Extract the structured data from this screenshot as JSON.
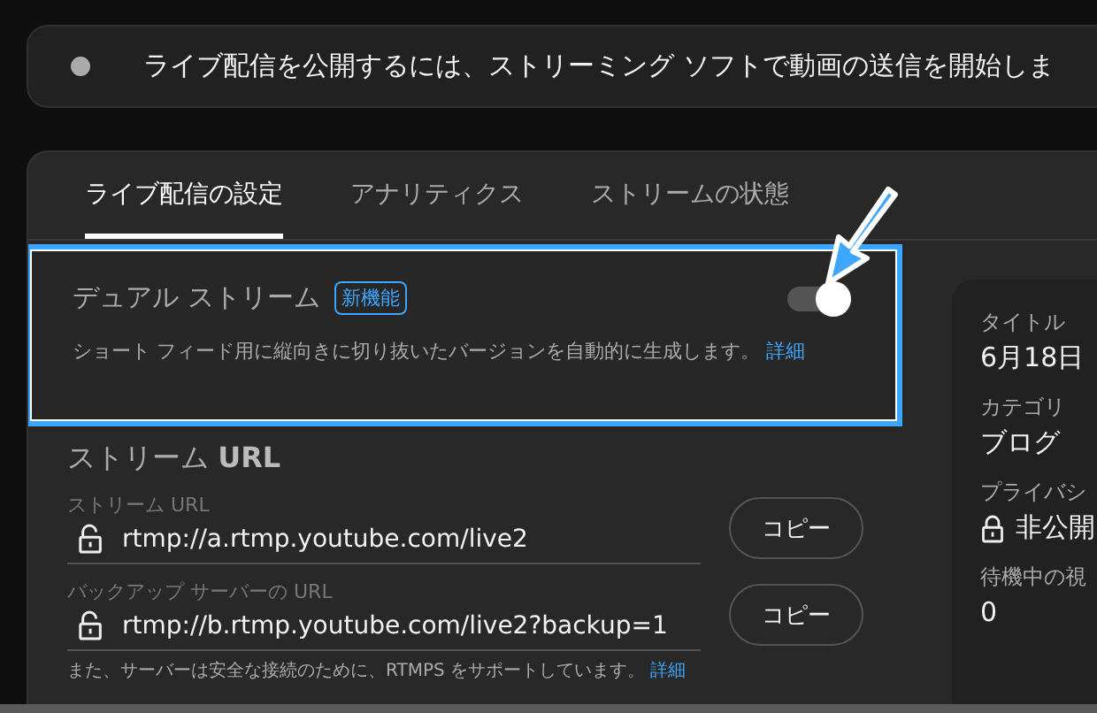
{
  "banner": {
    "text": "ライブ配信を公開するには、ストリーミング ソフトで動画の送信を開始しま"
  },
  "tabs": [
    {
      "label": "ライブ配信の設定",
      "selected": true
    },
    {
      "label": "アナリティクス",
      "selected": false
    },
    {
      "label": "ストリームの状態",
      "selected": false
    }
  ],
  "dual_stream": {
    "title": "デュアル ストリーム",
    "badge": "新機能",
    "description": "ショート フィード用に縦向きに切り抜いたバージョンを自動的に生成します。",
    "link": "詳細",
    "on": true
  },
  "stream_url": {
    "heading": "ストリーム **URL**",
    "fields": [
      {
        "label": "ストリーム URL",
        "value": "rtmp://a.rtmp.youtube.com/live2",
        "button": "コピー"
      },
      {
        "label": "バックアップ サーバーの URL",
        "value": "rtmp://b.rtmp.youtube.com/live2?backup=1",
        "button": "コピー"
      }
    ],
    "note": {
      "text": "また、サーバーは安全な接続のために、RTMPS をサポートしています。",
      "link": "詳細"
    }
  },
  "details": [
    {
      "label": "タイトル",
      "value": "6月18日",
      "locked": false
    },
    {
      "label": "カテゴリ",
      "value": "ブログ",
      "locked": false
    },
    {
      "label": "プライバシ",
      "value": "非公開",
      "locked": true
    },
    {
      "label": "待機中の視",
      "value": "0",
      "locked": false
    }
  ]
}
